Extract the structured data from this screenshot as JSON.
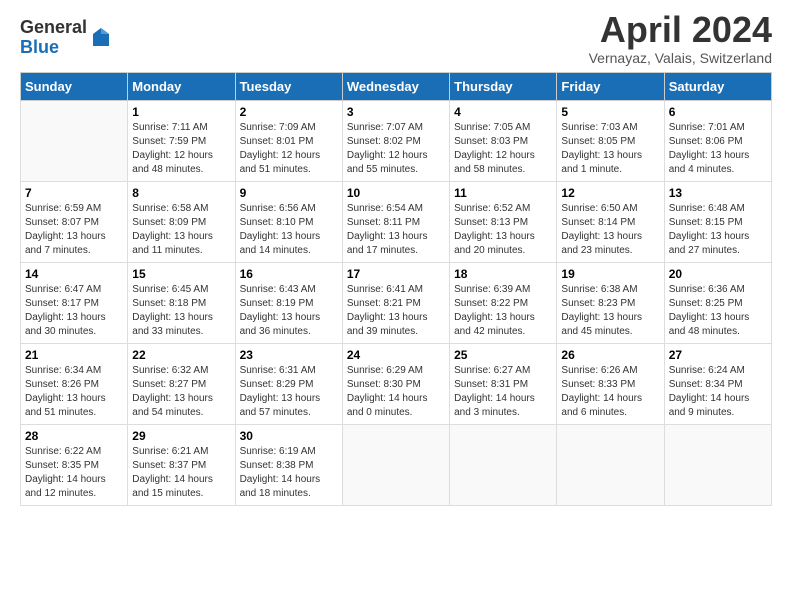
{
  "header": {
    "logo_general": "General",
    "logo_blue": "Blue",
    "title": "April 2024",
    "location": "Vernayaz, Valais, Switzerland"
  },
  "calendar": {
    "days_of_week": [
      "Sunday",
      "Monday",
      "Tuesday",
      "Wednesday",
      "Thursday",
      "Friday",
      "Saturday"
    ],
    "weeks": [
      [
        {
          "day": "",
          "sunrise": "",
          "sunset": "",
          "daylight": "",
          "empty": true
        },
        {
          "day": "1",
          "sunrise": "7:11 AM",
          "sunset": "7:59 PM",
          "daylight": "12 hours and 48 minutes."
        },
        {
          "day": "2",
          "sunrise": "7:09 AM",
          "sunset": "8:01 PM",
          "daylight": "12 hours and 51 minutes."
        },
        {
          "day": "3",
          "sunrise": "7:07 AM",
          "sunset": "8:02 PM",
          "daylight": "12 hours and 55 minutes."
        },
        {
          "day": "4",
          "sunrise": "7:05 AM",
          "sunset": "8:03 PM",
          "daylight": "12 hours and 58 minutes."
        },
        {
          "day": "5",
          "sunrise": "7:03 AM",
          "sunset": "8:05 PM",
          "daylight": "13 hours and 1 minute."
        },
        {
          "day": "6",
          "sunrise": "7:01 AM",
          "sunset": "8:06 PM",
          "daylight": "13 hours and 4 minutes."
        }
      ],
      [
        {
          "day": "7",
          "sunrise": "6:59 AM",
          "sunset": "8:07 PM",
          "daylight": "13 hours and 7 minutes."
        },
        {
          "day": "8",
          "sunrise": "6:58 AM",
          "sunset": "8:09 PM",
          "daylight": "13 hours and 11 minutes."
        },
        {
          "day": "9",
          "sunrise": "6:56 AM",
          "sunset": "8:10 PM",
          "daylight": "13 hours and 14 minutes."
        },
        {
          "day": "10",
          "sunrise": "6:54 AM",
          "sunset": "8:11 PM",
          "daylight": "13 hours and 17 minutes."
        },
        {
          "day": "11",
          "sunrise": "6:52 AM",
          "sunset": "8:13 PM",
          "daylight": "13 hours and 20 minutes."
        },
        {
          "day": "12",
          "sunrise": "6:50 AM",
          "sunset": "8:14 PM",
          "daylight": "13 hours and 23 minutes."
        },
        {
          "day": "13",
          "sunrise": "6:48 AM",
          "sunset": "8:15 PM",
          "daylight": "13 hours and 27 minutes."
        }
      ],
      [
        {
          "day": "14",
          "sunrise": "6:47 AM",
          "sunset": "8:17 PM",
          "daylight": "13 hours and 30 minutes."
        },
        {
          "day": "15",
          "sunrise": "6:45 AM",
          "sunset": "8:18 PM",
          "daylight": "13 hours and 33 minutes."
        },
        {
          "day": "16",
          "sunrise": "6:43 AM",
          "sunset": "8:19 PM",
          "daylight": "13 hours and 36 minutes."
        },
        {
          "day": "17",
          "sunrise": "6:41 AM",
          "sunset": "8:21 PM",
          "daylight": "13 hours and 39 minutes."
        },
        {
          "day": "18",
          "sunrise": "6:39 AM",
          "sunset": "8:22 PM",
          "daylight": "13 hours and 42 minutes."
        },
        {
          "day": "19",
          "sunrise": "6:38 AM",
          "sunset": "8:23 PM",
          "daylight": "13 hours and 45 minutes."
        },
        {
          "day": "20",
          "sunrise": "6:36 AM",
          "sunset": "8:25 PM",
          "daylight": "13 hours and 48 minutes."
        }
      ],
      [
        {
          "day": "21",
          "sunrise": "6:34 AM",
          "sunset": "8:26 PM",
          "daylight": "13 hours and 51 minutes."
        },
        {
          "day": "22",
          "sunrise": "6:32 AM",
          "sunset": "8:27 PM",
          "daylight": "13 hours and 54 minutes."
        },
        {
          "day": "23",
          "sunrise": "6:31 AM",
          "sunset": "8:29 PM",
          "daylight": "13 hours and 57 minutes."
        },
        {
          "day": "24",
          "sunrise": "6:29 AM",
          "sunset": "8:30 PM",
          "daylight": "14 hours and 0 minutes."
        },
        {
          "day": "25",
          "sunrise": "6:27 AM",
          "sunset": "8:31 PM",
          "daylight": "14 hours and 3 minutes."
        },
        {
          "day": "26",
          "sunrise": "6:26 AM",
          "sunset": "8:33 PM",
          "daylight": "14 hours and 6 minutes."
        },
        {
          "day": "27",
          "sunrise": "6:24 AM",
          "sunset": "8:34 PM",
          "daylight": "14 hours and 9 minutes."
        }
      ],
      [
        {
          "day": "28",
          "sunrise": "6:22 AM",
          "sunset": "8:35 PM",
          "daylight": "14 hours and 12 minutes."
        },
        {
          "day": "29",
          "sunrise": "6:21 AM",
          "sunset": "8:37 PM",
          "daylight": "14 hours and 15 minutes."
        },
        {
          "day": "30",
          "sunrise": "6:19 AM",
          "sunset": "8:38 PM",
          "daylight": "14 hours and 18 minutes."
        },
        {
          "day": "",
          "sunrise": "",
          "sunset": "",
          "daylight": "",
          "empty": true
        },
        {
          "day": "",
          "sunrise": "",
          "sunset": "",
          "daylight": "",
          "empty": true
        },
        {
          "day": "",
          "sunrise": "",
          "sunset": "",
          "daylight": "",
          "empty": true
        },
        {
          "day": "",
          "sunrise": "",
          "sunset": "",
          "daylight": "",
          "empty": true
        }
      ]
    ]
  }
}
